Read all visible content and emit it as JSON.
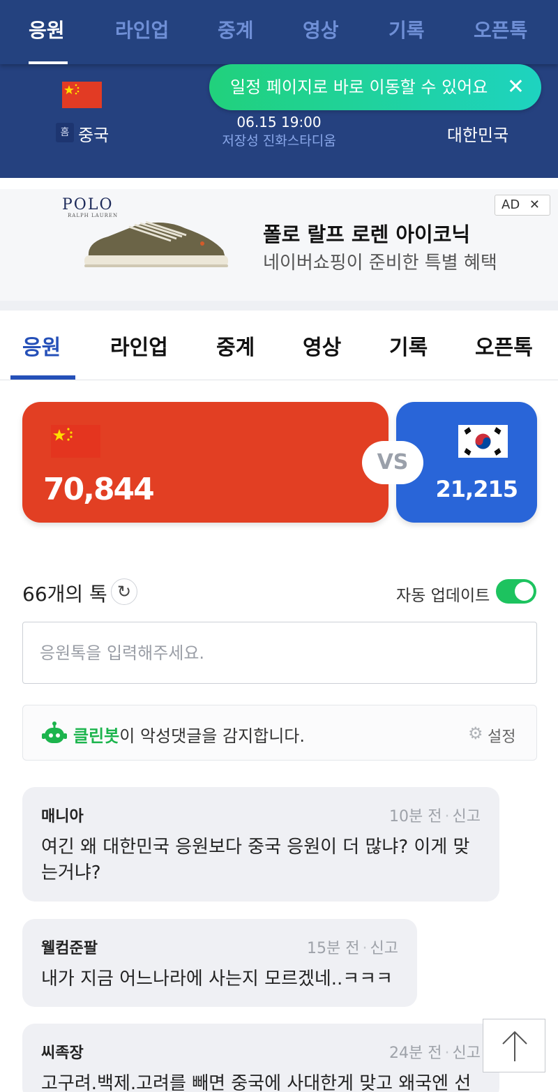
{
  "header": {
    "tabs": [
      {
        "label": "응원",
        "active": true
      },
      {
        "label": "라인업",
        "active": false
      },
      {
        "label": "중계",
        "active": false
      },
      {
        "label": "영상",
        "active": false
      },
      {
        "label": "기록",
        "active": false
      },
      {
        "label": "오픈톡",
        "active": false
      }
    ],
    "home_badge": "홈",
    "home_team": "중국",
    "away_team": "대한민국",
    "match_time": "06.15 19:00",
    "venue": "저장성 진화스타디움",
    "toast": {
      "text": "일정 페이지로 바로 이동할 수 있어요",
      "close": "✕"
    }
  },
  "ad": {
    "brand": "POLO",
    "brand_sub": "RALPH LAUREN",
    "title": "폴로 랄프 로렌 아이코닉",
    "desc": "네이버쇼핑이 준비한 특별 혜택",
    "badge": "AD",
    "badge_close": "✕"
  },
  "tabs": [
    {
      "label": "응원",
      "active": true
    },
    {
      "label": "라인업",
      "active": false
    },
    {
      "label": "중계",
      "active": false
    },
    {
      "label": "영상",
      "active": false
    },
    {
      "label": "기록",
      "active": false
    },
    {
      "label": "오픈톡",
      "active": false
    }
  ],
  "cheer": {
    "home_score": "70,844",
    "away_score": "21,215",
    "vs": "VS",
    "home_color": "#e23f23",
    "away_color": "#2965d8"
  },
  "talk": {
    "count_label": "66개의 톡",
    "refresh_icon": "↻",
    "auto_update_label": "자동 업데이트",
    "auto_update_on": true,
    "input_placeholder": "응원톡을 입력해주세요.",
    "cleanbot_name": "클린봇",
    "cleanbot_text": "이 악성댓글을 감지합니다.",
    "cleanbot_setting": "설정",
    "gear_icon": "⚙"
  },
  "comments": [
    {
      "author": "매니아",
      "time": "10분 전",
      "report": "신고",
      "lines": [
        "여긴 왜 대한민국 응원보다 중국 응원이 더 많냐? 이게 맞",
        "는거냐?"
      ]
    },
    {
      "author": "웰컴준팔",
      "time": "15분 전",
      "report": "신고",
      "lines": [
        "내가 지금 어느나라에 사는지 모르겠네..ㅋㅋㅋ"
      ]
    },
    {
      "author": "씨족장",
      "time": "24분 전",
      "report": "신고",
      "lines": [
        "고구려.백제.고려를 빼면 중국에 사대한게 맞고 왜국엔 선"
      ]
    }
  ],
  "scroll_top_icon": "arrow-up-icon"
}
